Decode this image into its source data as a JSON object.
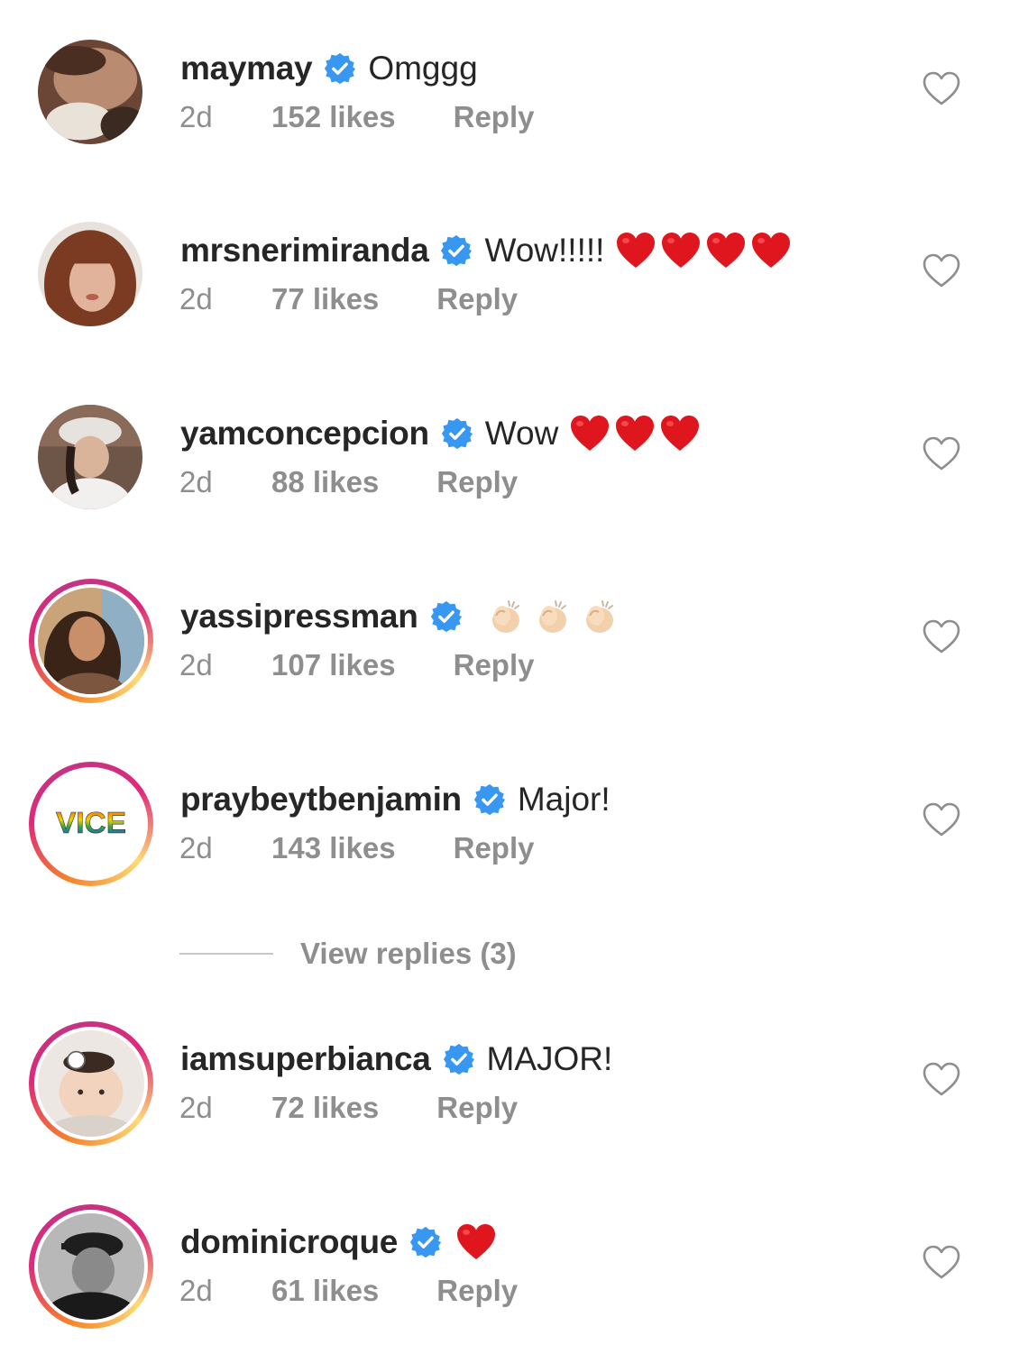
{
  "comments": [
    {
      "username": "maymay",
      "text": "Omggg",
      "emojis": [],
      "time": "2d",
      "likes": "152 likes",
      "reply_label": "Reply",
      "story_ring": false,
      "avatar": "sleeping-face-photo"
    },
    {
      "username": "mrsnerimiranda",
      "text": "Wow!!!!!",
      "emojis": [
        "red-heart",
        "red-heart",
        "red-heart",
        "red-heart"
      ],
      "time": "2d",
      "likes": "77 likes",
      "reply_label": "Reply",
      "story_ring": false,
      "avatar": "woman-bangs-photo"
    },
    {
      "username": "yamconcepcion",
      "text": "Wow",
      "emojis": [
        "red-heart",
        "red-heart",
        "red-heart"
      ],
      "time": "2d",
      "likes": "88 likes",
      "reply_label": "Reply",
      "story_ring": false,
      "avatar": "woman-bucket-hat-photo"
    },
    {
      "username": "yassipressman",
      "text": "",
      "emojis": [
        "clapping-hands-light",
        "clapping-hands-light",
        "clapping-hands-light"
      ],
      "time": "2d",
      "likes": "107 likes",
      "reply_label": "Reply",
      "story_ring": true,
      "avatar": "woman-long-hair-photo"
    },
    {
      "username": "praybeytbenjamin",
      "text": "Major!",
      "emojis": [],
      "time": "2d",
      "likes": "143 likes",
      "reply_label": "Reply",
      "story_ring": true,
      "avatar": "vice-rainbow-logo",
      "avatar_text": "VICE"
    },
    {
      "username": "iamsuperbianca",
      "text": "MAJOR!",
      "emojis": [],
      "time": "2d",
      "likes": "72 likes",
      "reply_label": "Reply",
      "story_ring": true,
      "avatar": "baby-photo"
    },
    {
      "username": "dominicroque",
      "text": "",
      "emojis": [
        "red-heart"
      ],
      "time": "2d",
      "likes": "61 likes",
      "reply_label": "Reply",
      "story_ring": true,
      "avatar": "man-cap-bw-photo"
    }
  ],
  "view_replies": {
    "label": "View replies (3)"
  },
  "colors": {
    "verified_blue": "#3897f0",
    "meta_gray": "#8e8e8e",
    "heart_red": "#e0161e",
    "text": "#262626"
  }
}
